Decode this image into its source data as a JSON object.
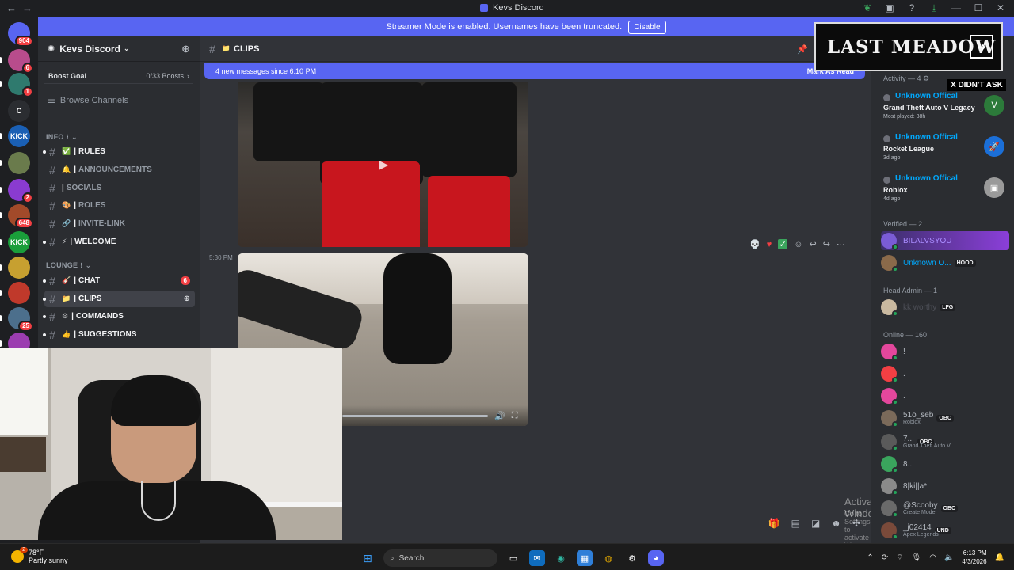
{
  "window": {
    "title": "Kevs Discord"
  },
  "streamer_banner": {
    "text": "Streamer Mode is enabled. Usernames have been truncated.",
    "button": "Disable"
  },
  "servers": [
    {
      "label": "",
      "badge": "904",
      "color": "#5865f2",
      "icon": "discord-home-icon"
    },
    {
      "label": "",
      "badge": "6",
      "color": "#b84c8c"
    },
    {
      "label": "",
      "badge": "1",
      "color": "#2f7a6e"
    },
    {
      "label": "C",
      "badge": "",
      "color": "#2b2d31"
    },
    {
      "label": "KICK",
      "badge": "",
      "color": "#1a5fb4"
    },
    {
      "label": "",
      "badge": "",
      "color": "#6a7b4c"
    },
    {
      "label": "",
      "badge": "2",
      "color": "#8a3bd0"
    },
    {
      "label": "",
      "badge": "648",
      "color": "#a24a2a"
    },
    {
      "label": "KICK",
      "badge": "",
      "color": "#1a9e3a"
    },
    {
      "label": "",
      "badge": "",
      "color": "#c7a030"
    },
    {
      "label": "",
      "badge": "",
      "color": "#c0392b"
    },
    {
      "label": "",
      "badge": "25",
      "color": "#4c6f8c"
    },
    {
      "label": "",
      "badge": "",
      "color": "#9c3db0"
    }
  ],
  "guild": {
    "name": "Kevs Discord",
    "boost_label": "Boost Goal",
    "boost_count": "0/33 Boosts",
    "browse": "Browse Channels",
    "categories": [
      {
        "label": "INFO"
      },
      {
        "label": "LOUNGE"
      }
    ],
    "channels": [
      {
        "name": "RULES",
        "emoji": "✅",
        "bright": true
      },
      {
        "name": "ANNOUNCEMENTS",
        "emoji": "🔔",
        "bright": false
      },
      {
        "name": "SOCIALS",
        "emoji": "",
        "bright": false
      },
      {
        "name": "ROLES",
        "emoji": "🎨",
        "bright": false
      },
      {
        "name": "INVITE-LINK",
        "emoji": "🔗",
        "bright": false
      },
      {
        "name": "WELCOME",
        "emoji": "⚡",
        "bright": true
      },
      {
        "name": "CHAT",
        "emoji": "🎸",
        "bright": true,
        "badge": "6"
      },
      {
        "name": "CLIPS",
        "emoji": "📁",
        "bright": true,
        "selected": true
      },
      {
        "name": "COMMANDS",
        "emoji": "⚙",
        "bright": true
      },
      {
        "name": "SUGGESTIONS",
        "emoji": "👍",
        "bright": true
      }
    ]
  },
  "chat": {
    "channel_name": "CLIPS",
    "new_messages": "4 new messages since 6:10 PM",
    "mark_read": "Mark As Read",
    "timestamp": "5:30 PM",
    "watermark_title": "Activate Windows",
    "watermark_sub": "Go to Settings to activate Windows."
  },
  "overlay": {
    "logo": "LAST MEADOW",
    "tag": "X DIDN'T ASK"
  },
  "members": {
    "activity_header": "Activity — 4",
    "activities": [
      {
        "name": "Unknown Offical",
        "game": "Grand Theft Auto V Legacy",
        "sub": "Most played: 38h",
        "color": "#2c7a3a"
      },
      {
        "name": "Unknown Offical",
        "game": "Rocket League",
        "sub": "3d ago",
        "color": "#1b6fd8"
      },
      {
        "name": "Unknown Offical",
        "game": "Roblox",
        "sub": "4d ago",
        "color": "#9a9a9a"
      }
    ],
    "verified_header": "Verified — 2",
    "verified": [
      {
        "name": "BILALVSYOU",
        "tag": ""
      },
      {
        "name": "Unknown O...",
        "tag": "HOOD"
      }
    ],
    "admin_header": "Head Admin — 1",
    "admin": {
      "name": "kk worthy",
      "tag": "LFG"
    },
    "online_header": "Online — 160",
    "online": [
      {
        "name": "!",
        "tag": "",
        "sub": "",
        "color": "#e3479c"
      },
      {
        "name": ".",
        "tag": "",
        "sub": "",
        "color": "#f23f43"
      },
      {
        "name": ".",
        "tag": "",
        "sub": "",
        "color": "#e3479c"
      },
      {
        "name": "51o_seb",
        "tag": "OBC",
        "sub": "Roblox",
        "color": "#7b6a5a"
      },
      {
        "name": "7...",
        "tag": "OBC",
        "sub": "Grand Theft Auto V",
        "color": "#5a5a5a"
      },
      {
        "name": "8...",
        "tag": "",
        "sub": "",
        "color": "#3aa55d"
      },
      {
        "name": "8|ki||a*",
        "tag": "",
        "sub": "",
        "color": "#8a8a8a"
      },
      {
        "name": "@Scooby",
        "tag": "OBC",
        "sub": "Create Mode",
        "color": "#6a6a6a"
      },
      {
        "name": "_j02414",
        "tag": "UND",
        "sub": "Apex Legends",
        "color": "#7a4a3a"
      }
    ]
  },
  "taskbar": {
    "temp": "78°F",
    "weather": "Partly sunny",
    "weather_badge": "2",
    "search_placeholder": "Search",
    "time": "6:13 PM",
    "date": "4/3/2026"
  }
}
